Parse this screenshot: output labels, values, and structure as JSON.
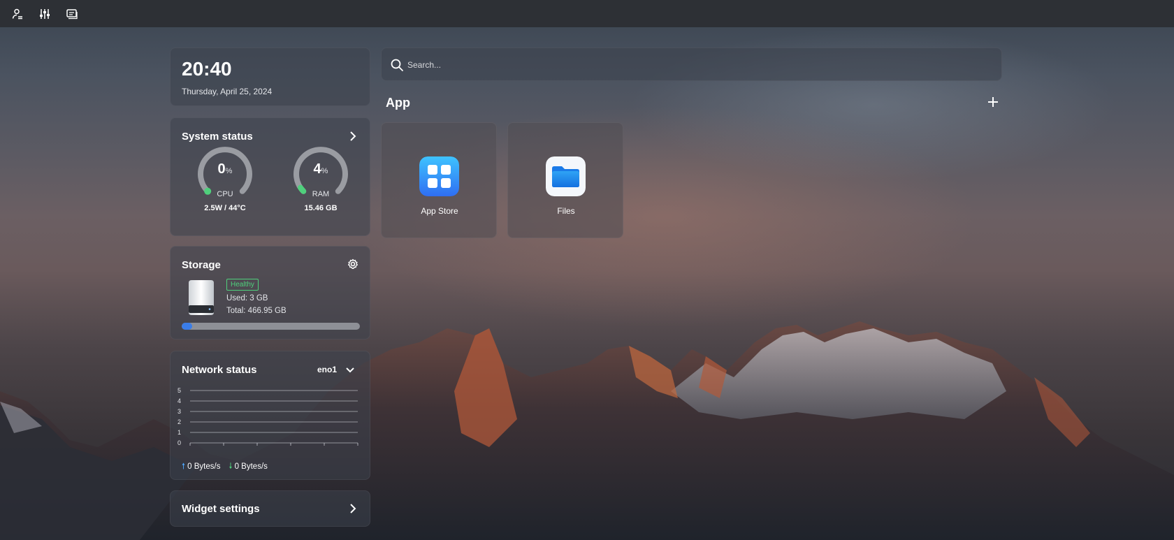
{
  "topbar": {
    "buttons": [
      {
        "icon": "user-settings-icon"
      },
      {
        "icon": "sliders-icon"
      },
      {
        "icon": "screen-icon"
      }
    ]
  },
  "clock": {
    "time": "20:40",
    "date": "Thursday, April 25, 2024"
  },
  "system_status": {
    "title": "System status",
    "cpu": {
      "value": "0",
      "unit": "%",
      "label": "CPU",
      "detail": "2.5W / 44°C",
      "percent": 0
    },
    "ram": {
      "value": "4",
      "unit": "%",
      "label": "RAM",
      "detail": "15.46 GB",
      "percent": 4
    },
    "accent_color": "#4fd07c"
  },
  "storage": {
    "title": "Storage",
    "status": "Healthy",
    "used": "Used: 3 GB",
    "total": "Total: 466.95 GB",
    "used_fraction": 0.03,
    "bar_color": "#3a7de8"
  },
  "network": {
    "title": "Network status",
    "interface": "eno1",
    "y_ticks": [
      "5",
      "4",
      "3",
      "2",
      "1",
      "0"
    ],
    "upload": "0 Bytes/s",
    "download": "0 Bytes/s"
  },
  "widget_settings": {
    "label": "Widget settings"
  },
  "search": {
    "placeholder": "Search..."
  },
  "apps": {
    "section_title": "App",
    "items": [
      {
        "label": "App Store",
        "icon": "app-store-icon"
      },
      {
        "label": "Files",
        "icon": "files-folder-icon"
      }
    ]
  }
}
